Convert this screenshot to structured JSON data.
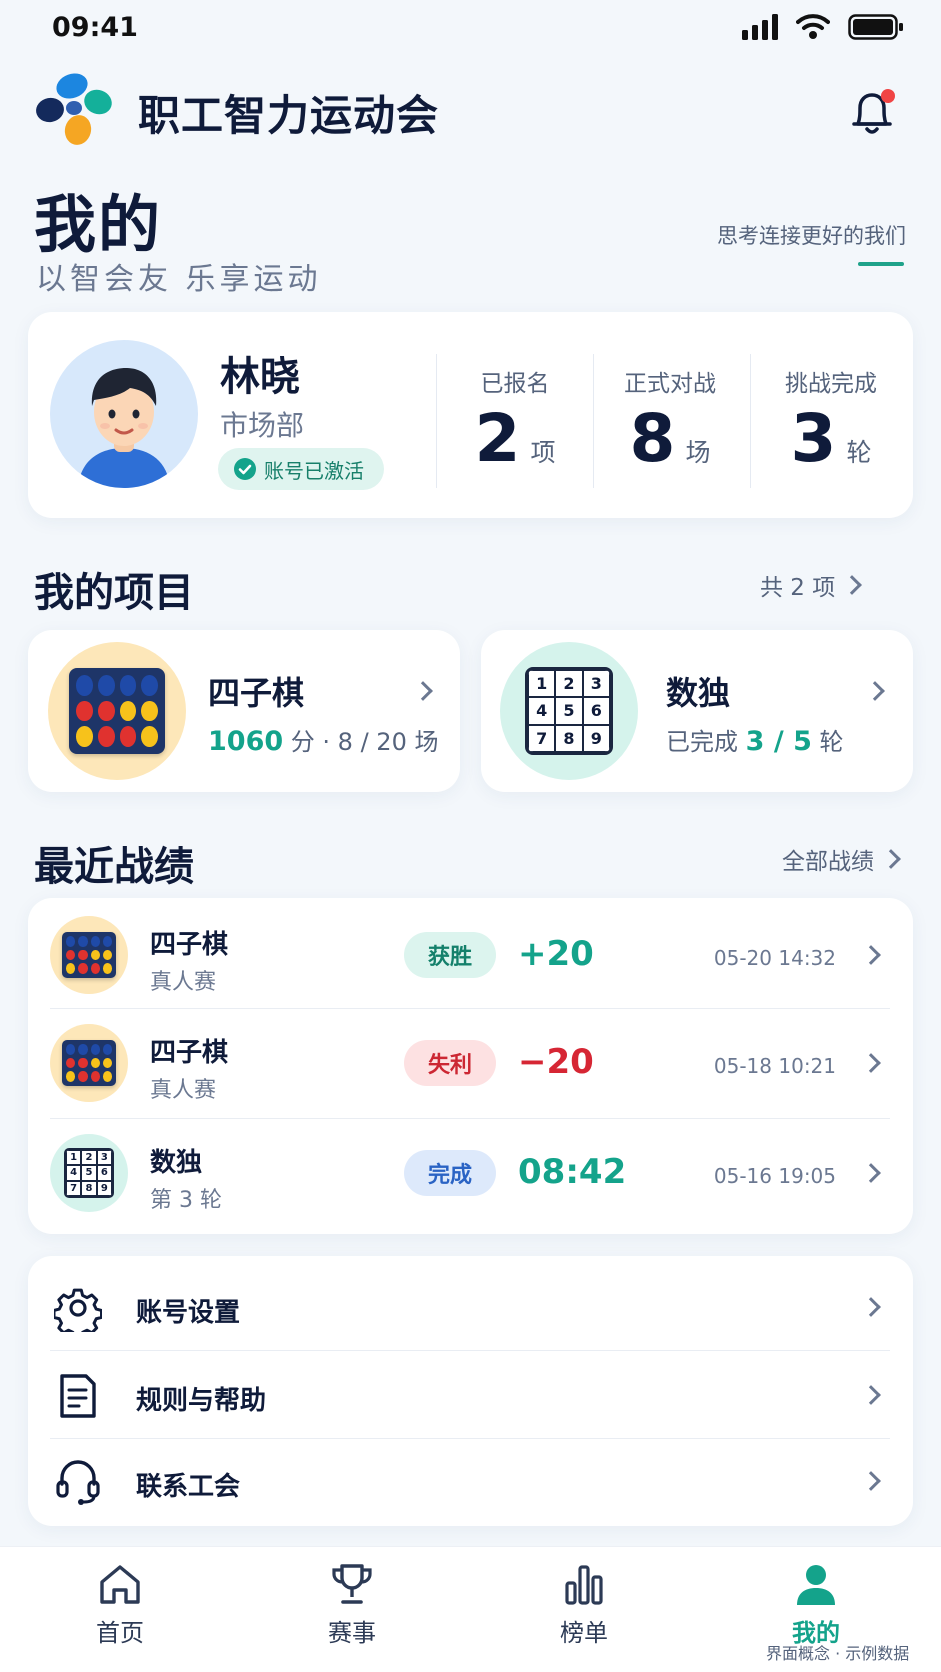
{
  "status_bar": {
    "time": "09:41"
  },
  "app": {
    "title": "职工智力运动会"
  },
  "header": {
    "title": "我的",
    "subtitle": "以智会友 乐享运动",
    "slogan": "思考连接更好的我们"
  },
  "profile": {
    "name": "林晓",
    "department": "市场部",
    "status": "账号已激活",
    "stats": [
      {
        "label": "已报名",
        "value": "2",
        "unit": "项"
      },
      {
        "label": "正式对战",
        "value": "8",
        "unit": "场"
      },
      {
        "label": "挑战完成",
        "value": "3",
        "unit": "轮"
      }
    ]
  },
  "projects": {
    "title": "我的项目",
    "count_link": "共 2 项",
    "items": [
      {
        "name": "四子棋",
        "score": "1060",
        "meta": "分 · 8 / 20 场",
        "icon": "connect-four-icon"
      },
      {
        "name": "数独",
        "prefix": "已完成",
        "progress": "3 / 5",
        "suffix": "轮",
        "icon": "sudoku-icon"
      }
    ]
  },
  "sudoku_digits": [
    "1",
    "2",
    "3",
    "4",
    "5",
    "6",
    "7",
    "8",
    "9"
  ],
  "records": {
    "title": "最近战绩",
    "all_link": "全部战绩",
    "items": [
      {
        "game": "四子棋",
        "type": "真人赛",
        "result": "获胜",
        "score": "+20",
        "time": "05-20  14:32",
        "icon": "connect-four-icon",
        "tone": "#14a38b"
      },
      {
        "game": "四子棋",
        "type": "真人赛",
        "result": "失利",
        "score": "−20",
        "time": "05-18  10:21",
        "icon": "connect-four-icon",
        "tone": "#d62634"
      },
      {
        "game": "数独",
        "type": "第 3 轮",
        "result": "完成",
        "score": "08:42",
        "time": "05-16  19:05",
        "icon": "sudoku-icon",
        "tone": "#14a38b"
      }
    ]
  },
  "menu": [
    {
      "label": "账号设置",
      "icon": "gear-icon"
    },
    {
      "label": "规则与帮助",
      "icon": "document-icon"
    },
    {
      "label": "联系工会",
      "icon": "headset-icon"
    }
  ],
  "tabs": [
    {
      "label": "首页",
      "icon": "home-icon"
    },
    {
      "label": "赛事",
      "icon": "trophy-icon"
    },
    {
      "label": "榜单",
      "icon": "bar-chart-icon"
    },
    {
      "label": "我的",
      "icon": "person-icon",
      "active": true
    }
  ],
  "footnote": "界面概念 · 示例数据",
  "colors": {
    "accent": "#14a38b",
    "danger": "#d62634",
    "navy": "#0f1b3a"
  }
}
